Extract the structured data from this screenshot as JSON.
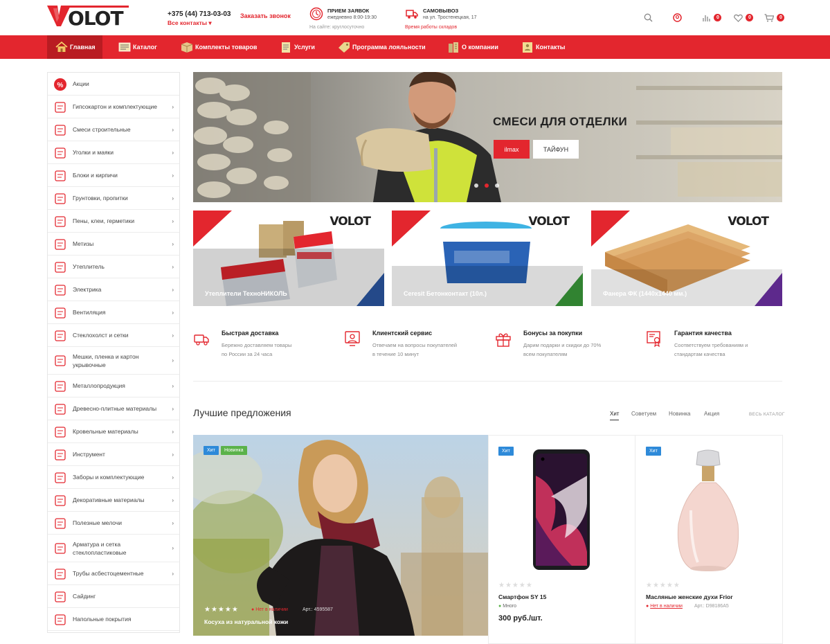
{
  "header": {
    "logo_text": "OLOT",
    "phone": "+375 (44) 713-03-03",
    "all_contacts": "Все контакты ▾",
    "callback": "Заказать звонок",
    "orders": {
      "title": "ПРИЕМ ЗАЯВОК",
      "hours": "ежедневно 8:00-19:30",
      "note": "На сайте: круглосуточно"
    },
    "pickup": {
      "title": "САМОВЫВОЗ",
      "address": "на ул. Тростенецкая, 17",
      "note": "Время работы складов"
    },
    "compare_count": "0",
    "favorites_count": "0",
    "cart_count": "0"
  },
  "nav": [
    {
      "label": "Главная",
      "icon": "home-icon"
    },
    {
      "label": "Каталог",
      "icon": "catalog-icon"
    },
    {
      "label": "Комплекты товаров",
      "icon": "box-icon"
    },
    {
      "label": "Услуги",
      "icon": "clipboard-icon"
    },
    {
      "label": "Программа лояльности",
      "icon": "tag-icon"
    },
    {
      "label": "О компании",
      "icon": "building-icon"
    },
    {
      "label": "Контакты",
      "icon": "contacts-icon"
    }
  ],
  "sidebar": [
    {
      "label": "Акции",
      "arrow": false
    },
    {
      "label": "Гипсокартон и комплектующие",
      "arrow": true
    },
    {
      "label": "Смеси строительные",
      "arrow": true
    },
    {
      "label": "Уголки и маяки",
      "arrow": true
    },
    {
      "label": "Блоки и кирпичи",
      "arrow": true
    },
    {
      "label": "Грунтовки, пропитки",
      "arrow": true
    },
    {
      "label": "Пены, клеи, герметики",
      "arrow": true
    },
    {
      "label": "Метизы",
      "arrow": true
    },
    {
      "label": "Утеплитель",
      "arrow": true
    },
    {
      "label": "Электрика",
      "arrow": true
    },
    {
      "label": "Вентиляция",
      "arrow": true
    },
    {
      "label": "Стеклохолст и сетки",
      "arrow": true
    },
    {
      "label": "Мешки, пленка и картон укрывочные",
      "arrow": true
    },
    {
      "label": "Металлопродукция",
      "arrow": true
    },
    {
      "label": "Древесно-плитные материалы",
      "arrow": true
    },
    {
      "label": "Кровельные материалы",
      "arrow": true
    },
    {
      "label": "Инструмент",
      "arrow": true
    },
    {
      "label": "Заборы и комплектующие",
      "arrow": true
    },
    {
      "label": "Декоративные материалы",
      "arrow": true
    },
    {
      "label": "Полезные мелочи",
      "arrow": true
    },
    {
      "label": "Арматура и сетка стеклопластиковые",
      "arrow": true
    },
    {
      "label": "Трубы асбестоцементные",
      "arrow": true
    },
    {
      "label": "Сайдинг",
      "arrow": false
    },
    {
      "label": "Напольные покрытия",
      "arrow": false
    }
  ],
  "banner": {
    "title": "СМЕСИ ДЛЯ ОТДЕЛКИ",
    "btn1": "ilmax",
    "btn2": "ТАЙФУН",
    "slides": 3,
    "active_slide": 2
  },
  "promos": [
    {
      "caption": "Утеплители ТехноНИКОЛЬ",
      "logo": "VOLOT"
    },
    {
      "caption": "Ceresit Бетонконтакт (10л.)",
      "logo": "VOLOT"
    },
    {
      "caption": "Фанера ФК (1440х1440 мм.)",
      "logo": "VOLOT"
    }
  ],
  "features": [
    {
      "title": "Быстрая доставка",
      "desc1": "Бережно доставляем товары",
      "desc2": "по России за 24 часа"
    },
    {
      "title": "Клиентский сервис",
      "desc1": "Отвечаем на вопросы покупателей",
      "desc2": "в течение 10 минут"
    },
    {
      "title": "Бонусы за покупки",
      "desc1": "Дарим подарки и скидки до 70%",
      "desc2": "всем покупателям"
    },
    {
      "title": "Гарантия качества",
      "desc1": "Соответствуем требованиям и",
      "desc2": "стандартам качества"
    }
  ],
  "offers": {
    "title": "Лучшие предложения",
    "tabs": [
      "Хит",
      "Советуем",
      "Новинка",
      "Акция"
    ],
    "all_catalog": "ВЕСЬ КАТАЛОГ",
    "products": [
      {
        "name": "Косуха из натуральной кожи",
        "tags": [
          "Хит",
          "Новинка"
        ],
        "stock": "Нет в наличии",
        "art": "Арт.: 4595587",
        "rating": 0
      },
      {
        "name": "Смартфон SY 15",
        "tags": [
          "Хит"
        ],
        "stock": "Много",
        "price": "300 руб./шт.",
        "rating": 0
      },
      {
        "name": "Масляные женские духи Frior",
        "tags": [
          "Хит"
        ],
        "stock": "Нет в наличии",
        "art": "Арт.: D98186A5",
        "rating": 0
      }
    ]
  },
  "colors": {
    "accent": "#e3262e",
    "nav_active": "#b91c22",
    "tag_hit": "#2e8ad9",
    "tag_new": "#5bb24a"
  }
}
